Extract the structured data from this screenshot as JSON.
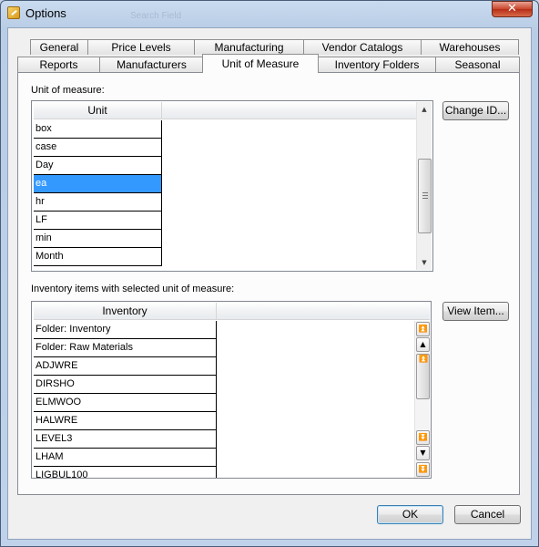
{
  "window": {
    "title": "Options",
    "ghost_text": "Search Field",
    "close_glyph": "✕"
  },
  "tabs": {
    "row1": [
      "General",
      "Price Levels",
      "Manufacturing",
      "Vendor Catalogs",
      "Warehouses"
    ],
    "row2": [
      "Reports",
      "Manufacturers",
      "Unit of Measure",
      "Inventory Folders",
      "Seasonal"
    ],
    "active": "Unit of Measure"
  },
  "uom": {
    "section_label": "Unit of measure:",
    "column_header": "Unit",
    "rows": [
      "box",
      "case",
      "Day",
      "ea",
      "hr",
      "LF",
      "min",
      "Month"
    ],
    "selected": "ea",
    "change_id_button": "Change ID..."
  },
  "inventory": {
    "section_label": "Inventory items with selected unit of measure:",
    "column_header": "Inventory",
    "rows": [
      "Folder:  Inventory",
      "Folder:  Raw Materials",
      "ADJWRE",
      "DIRSHO",
      "ELMWOO",
      "HALWRE",
      "LEVEL3",
      "LHAM",
      "LIGBUL100"
    ],
    "view_item_button": "View Item..."
  },
  "scroll_glyphs": {
    "up": "▲",
    "down": "▼",
    "top": "⏫",
    "bottom": "⏬"
  },
  "footer": {
    "ok": "OK",
    "cancel": "Cancel"
  },
  "colors": {
    "selection": "#3399ff",
    "close_button": "#c9452b"
  }
}
